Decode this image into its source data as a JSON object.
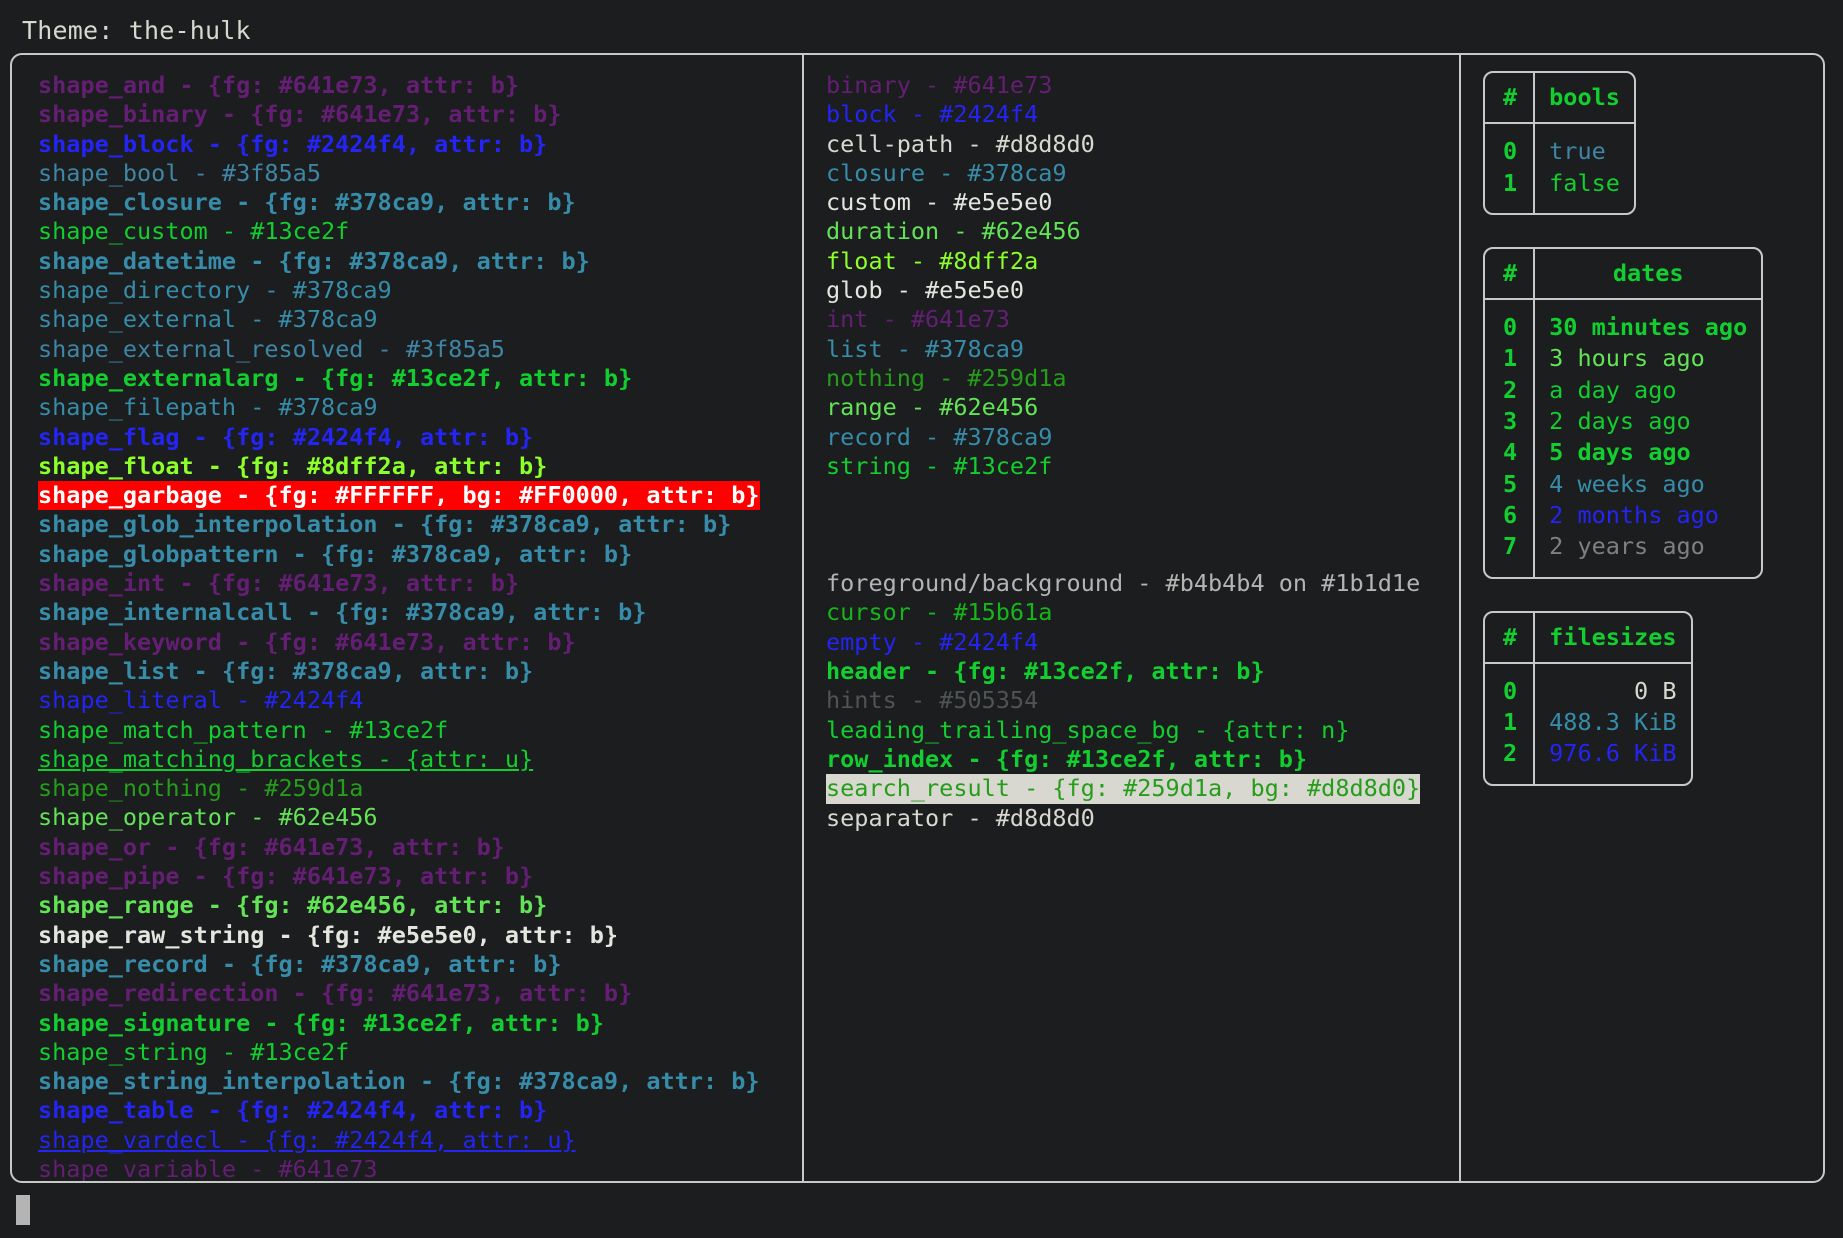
{
  "header": {
    "label": "Theme: the-hulk"
  },
  "palette": {
    "purple": "#641e73",
    "blue": "#2424f4",
    "steel": "#3f85a5",
    "teal": "#378ca9",
    "green": "#13ce2f",
    "lime": "#8dff2a",
    "midgreen": "#62e456",
    "darkgreen": "#259d1a",
    "white": "#e5e5e0",
    "lightgray": "#d8d8d0",
    "gray": "#b4b4b4",
    "dimgray": "#505354",
    "cursor": "#15b61a",
    "background": "#1b1d1e",
    "red_bg": "#FF0000",
    "red_fg": "#FFFFFF"
  },
  "left_pane": {
    "name": "shapes-column",
    "rows": [
      {
        "text": "shape_and - {fg: #641e73, attr: b}",
        "color": "#641e73",
        "bold": true
      },
      {
        "text": "shape_binary - {fg: #641e73, attr: b}",
        "color": "#641e73",
        "bold": true
      },
      {
        "text": "shape_block - {fg: #2424f4, attr: b}",
        "color": "#2424f4",
        "bold": true
      },
      {
        "text": "shape_bool - #3f85a5",
        "color": "#3f85a5",
        "bold": false
      },
      {
        "text": "shape_closure - {fg: #378ca9, attr: b}",
        "color": "#378ca9",
        "bold": true
      },
      {
        "text": "shape_custom - #13ce2f",
        "color": "#13ce2f",
        "bold": false
      },
      {
        "text": "shape_datetime - {fg: #378ca9, attr: b}",
        "color": "#378ca9",
        "bold": true
      },
      {
        "text": "shape_directory - #378ca9",
        "color": "#378ca9",
        "bold": false
      },
      {
        "text": "shape_external - #378ca9",
        "color": "#378ca9",
        "bold": false
      },
      {
        "text": "shape_external_resolved - #3f85a5",
        "color": "#3f85a5",
        "bold": false
      },
      {
        "text": "shape_externalarg - {fg: #13ce2f, attr: b}",
        "color": "#13ce2f",
        "bold": true
      },
      {
        "text": "shape_filepath - #378ca9",
        "color": "#378ca9",
        "bold": false
      },
      {
        "text": "shape_flag - {fg: #2424f4, attr: b}",
        "color": "#2424f4",
        "bold": true
      },
      {
        "text": "shape_float - {fg: #8dff2a, attr: b}",
        "color": "#8dff2a",
        "bold": true
      },
      {
        "text": "shape_garbage - {fg: #FFFFFF, bg: #FF0000, attr: b}",
        "color": "#FFFFFF",
        "bg": "#FF0000",
        "bold": true
      },
      {
        "text": "shape_glob_interpolation - {fg: #378ca9, attr: b}",
        "color": "#378ca9",
        "bold": true
      },
      {
        "text": "shape_globpattern - {fg: #378ca9, attr: b}",
        "color": "#378ca9",
        "bold": true
      },
      {
        "text": "shape_int - {fg: #641e73, attr: b}",
        "color": "#641e73",
        "bold": true
      },
      {
        "text": "shape_internalcall - {fg: #378ca9, attr: b}",
        "color": "#378ca9",
        "bold": true
      },
      {
        "text": "shape_keyword - {fg: #641e73, attr: b}",
        "color": "#641e73",
        "bold": true
      },
      {
        "text": "shape_list - {fg: #378ca9, attr: b}",
        "color": "#378ca9",
        "bold": true
      },
      {
        "text": "shape_literal - #2424f4",
        "color": "#2424f4",
        "bold": false
      },
      {
        "text": "shape_match_pattern - #13ce2f",
        "color": "#13ce2f",
        "bold": false
      },
      {
        "text": "shape_matching_brackets - {attr: u}",
        "color": "#13ce2f",
        "bold": false,
        "underline": true
      },
      {
        "text": "shape_nothing - #259d1a",
        "color": "#259d1a",
        "bold": false
      },
      {
        "text": "shape_operator - #62e456",
        "color": "#62e456",
        "bold": false
      },
      {
        "text": "shape_or - {fg: #641e73, attr: b}",
        "color": "#641e73",
        "bold": true
      },
      {
        "text": "shape_pipe - {fg: #641e73, attr: b}",
        "color": "#641e73",
        "bold": true
      },
      {
        "text": "shape_range - {fg: #62e456, attr: b}",
        "color": "#62e456",
        "bold": true
      },
      {
        "text": "shape_raw_string - {fg: #e5e5e0, attr: b}",
        "color": "#e5e5e0",
        "bold": true
      },
      {
        "text": "shape_record - {fg: #378ca9, attr: b}",
        "color": "#378ca9",
        "bold": true
      },
      {
        "text": "shape_redirection - {fg: #641e73, attr: b}",
        "color": "#641e73",
        "bold": true
      },
      {
        "text": "shape_signature - {fg: #13ce2f, attr: b}",
        "color": "#13ce2f",
        "bold": true
      },
      {
        "text": "shape_string - #13ce2f",
        "color": "#13ce2f",
        "bold": false
      },
      {
        "text": "shape_string_interpolation - {fg: #378ca9, attr: b}",
        "color": "#378ca9",
        "bold": true
      },
      {
        "text": "shape_table - {fg: #2424f4, attr: b}",
        "color": "#2424f4",
        "bold": true
      },
      {
        "text": "shape_vardecl - {fg: #2424f4, attr: u}",
        "color": "#2424f4",
        "bold": false,
        "underline": true
      },
      {
        "text": "shape_variable - #641e73",
        "color": "#641e73",
        "bold": false
      }
    ]
  },
  "mid_pane": {
    "name": "types-column",
    "group_types": [
      {
        "text": "binary - #641e73",
        "color": "#641e73",
        "bold": false
      },
      {
        "text": "block - #2424f4",
        "color": "#2424f4",
        "bold": false
      },
      {
        "text": "cell-path - #d8d8d0",
        "color": "#d8d8d0",
        "bold": false
      },
      {
        "text": "closure - #378ca9",
        "color": "#378ca9",
        "bold": false
      },
      {
        "text": "custom - #e5e5e0",
        "color": "#e5e5e0",
        "bold": false
      },
      {
        "text": "duration - #62e456",
        "color": "#62e456",
        "bold": false
      },
      {
        "text": "float - #8dff2a",
        "color": "#8dff2a",
        "bold": false
      },
      {
        "text": "glob - #e5e5e0",
        "color": "#e5e5e0",
        "bold": false
      },
      {
        "text": "int - #641e73",
        "color": "#641e73",
        "bold": false
      },
      {
        "text": "list - #378ca9",
        "color": "#378ca9",
        "bold": false
      },
      {
        "text": "nothing - #259d1a",
        "color": "#259d1a",
        "bold": false
      },
      {
        "text": "range - #62e456",
        "color": "#62e456",
        "bold": false
      },
      {
        "text": "record - #378ca9",
        "color": "#378ca9",
        "bold": false
      },
      {
        "text": "string - #13ce2f",
        "color": "#13ce2f",
        "bold": false
      }
    ],
    "group_ui": [
      {
        "text": "foreground/background - #b4b4b4 on #1b1d1e",
        "color": "#b4b4b4",
        "bold": false
      },
      {
        "text": "cursor - #15b61a",
        "color": "#15b61a",
        "bold": false
      },
      {
        "text": "empty - #2424f4",
        "color": "#2424f4",
        "bold": false
      },
      {
        "text": "header - {fg: #13ce2f, attr: b}",
        "color": "#13ce2f",
        "bold": true
      },
      {
        "text": "hints - #505354",
        "color": "#505354",
        "bold": false
      },
      {
        "text": "leading_trailing_space_bg - {attr: n}",
        "color": "#13ce2f",
        "bold": false
      },
      {
        "text": "row_index - {fg: #13ce2f, attr: b}",
        "color": "#13ce2f",
        "bold": true
      },
      {
        "text": "search_result - {fg: #259d1a, bg: #d8d8d0}",
        "color": "#259d1a",
        "bg": "#d8d8d0",
        "bold": false
      },
      {
        "text": "separator - #d8d8d0",
        "color": "#d8d8d0",
        "bold": false
      }
    ]
  },
  "right_pane": {
    "name": "preview-tables",
    "tables": [
      {
        "name": "bools-table",
        "headers": [
          "#",
          "bools"
        ],
        "header_align": [
          "left",
          "center"
        ],
        "rows": [
          {
            "index": "0",
            "value": "true",
            "color": "#3f85a5",
            "bold": false
          },
          {
            "index": "1",
            "value": "false",
            "color": "#13ce2f",
            "bold": false
          }
        ]
      },
      {
        "name": "dates-table",
        "headers": [
          "#",
          "dates"
        ],
        "header_align": [
          "left",
          "center"
        ],
        "rows": [
          {
            "index": "0",
            "value": "30 minutes ago",
            "color": "#13ce2f",
            "bold": true
          },
          {
            "index": "1",
            "value": "3 hours ago",
            "color": "#62e456",
            "bold": false
          },
          {
            "index": "2",
            "value": "a day ago",
            "color": "#13ce2f",
            "bold": false
          },
          {
            "index": "3",
            "value": "2 days ago",
            "color": "#13ce2f",
            "bold": false
          },
          {
            "index": "4",
            "value": "5 days ago",
            "color": "#13ce2f",
            "bold": true
          },
          {
            "index": "5",
            "value": "4 weeks ago",
            "color": "#378ca9",
            "bold": false
          },
          {
            "index": "6",
            "value": "2 months ago",
            "color": "#2424f4",
            "bold": false
          },
          {
            "index": "7",
            "value": "2 years ago",
            "color": "#808080",
            "bold": false
          }
        ]
      },
      {
        "name": "filesizes-table",
        "headers": [
          "#",
          "filesizes"
        ],
        "header_align": [
          "left",
          "center"
        ],
        "rows": [
          {
            "index": "0",
            "value": "0 B",
            "color": "#d8d8d0",
            "bold": false,
            "align": "right"
          },
          {
            "index": "1",
            "value": "488.3 KiB",
            "color": "#378ca9",
            "bold": false,
            "align": "right"
          },
          {
            "index": "2",
            "value": "976.6 KiB",
            "color": "#2424f4",
            "bold": false,
            "align": "right"
          }
        ]
      }
    ]
  },
  "cursor": {
    "name": "terminal-cursor",
    "visible": true
  }
}
